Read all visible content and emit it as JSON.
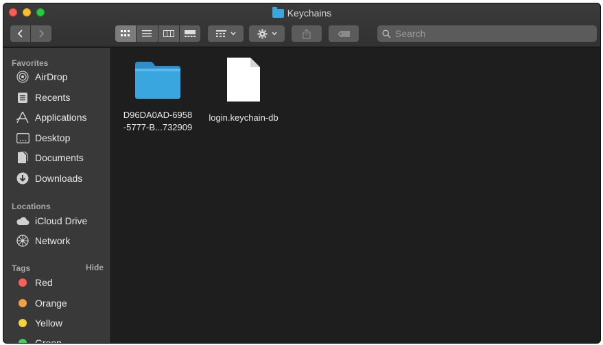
{
  "window": {
    "title": "Keychains"
  },
  "toolbar": {
    "back_icon": "chevron-left",
    "forward_icon": "chevron-right",
    "view_modes": [
      "icon-view",
      "list-view",
      "column-view",
      "gallery-view"
    ],
    "group_icon": "group-by",
    "action_icon": "gear",
    "share_icon": "share",
    "tag_icon": "tag",
    "search_placeholder": "Search"
  },
  "sidebar": {
    "favorites_label": "Favorites",
    "favorites": [
      {
        "label": "AirDrop",
        "icon": "airdrop-icon"
      },
      {
        "label": "Recents",
        "icon": "recents-icon"
      },
      {
        "label": "Applications",
        "icon": "applications-icon"
      },
      {
        "label": "Desktop",
        "icon": "desktop-icon"
      },
      {
        "label": "Documents",
        "icon": "documents-icon"
      },
      {
        "label": "Downloads",
        "icon": "downloads-icon"
      }
    ],
    "locations_label": "Locations",
    "locations": [
      {
        "label": "iCloud Drive",
        "icon": "cloud-icon"
      },
      {
        "label": "Network",
        "icon": "network-icon"
      }
    ],
    "tags_label": "Tags",
    "tags_hide": "Hide",
    "tags": [
      {
        "label": "Red",
        "color": "#ff5f57"
      },
      {
        "label": "Orange",
        "color": "#f5a03c"
      },
      {
        "label": "Yellow",
        "color": "#f5d33b"
      },
      {
        "label": "Green",
        "color": "#3ed15a"
      }
    ]
  },
  "files": [
    {
      "name_line1": "D96DA0AD-6958",
      "name_line2": "-5777-B...732909",
      "kind": "folder"
    },
    {
      "name_line1": "login.keychain-db",
      "name_line2": "",
      "kind": "document"
    }
  ],
  "colors": {
    "folder": "#3aa6e0",
    "accent": "#5b5b5b"
  }
}
